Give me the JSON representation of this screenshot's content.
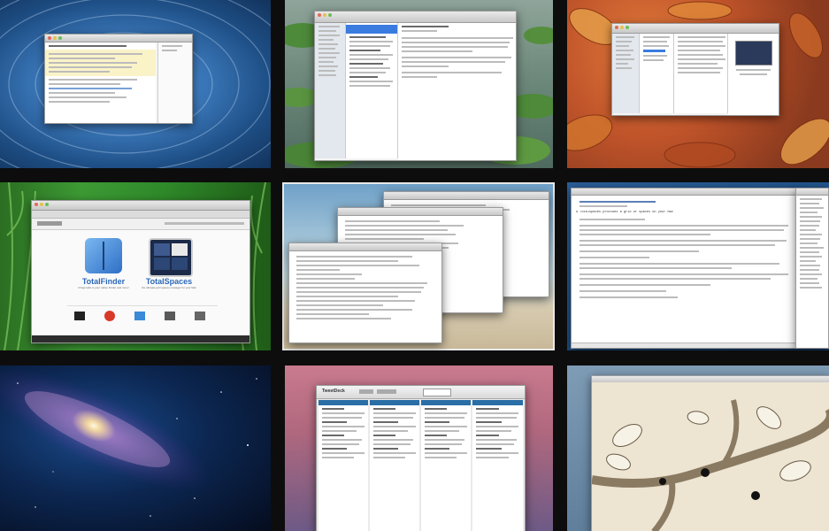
{
  "spaces": [
    {
      "name": "space-1"
    },
    {
      "name": "space-2"
    },
    {
      "name": "space-3"
    },
    {
      "name": "space-4"
    },
    {
      "name": "space-5"
    },
    {
      "name": "space-6"
    },
    {
      "name": "space-7"
    },
    {
      "name": "space-8"
    },
    {
      "name": "space-9"
    }
  ],
  "colors": {
    "selected_border": "#e8e8e8",
    "sea": "#3e7cbf",
    "lily": "#6e8a7c",
    "leaves": "#c0542a",
    "grass": "#2f8a2a",
    "beach": "#b9d1d9",
    "blue": "#1d4f86",
    "galaxy": "#0c2752",
    "pink": "#b0687e",
    "branch": "#e9dfcd"
  },
  "windows": {
    "totalfinder": {
      "title": "TotalFinder",
      "subtitle": "brings tabs to your native Finder and more!",
      "secondary_title": "TotalSpaces",
      "secondary_subtitle": "the ultimate grid spaces manager for your Mac"
    },
    "tweetdeck": {
      "brand": "TweetDeck"
    },
    "text_editor": {
      "heading": "# TotalSpaces provides a grid of spaces on your Mac"
    }
  }
}
